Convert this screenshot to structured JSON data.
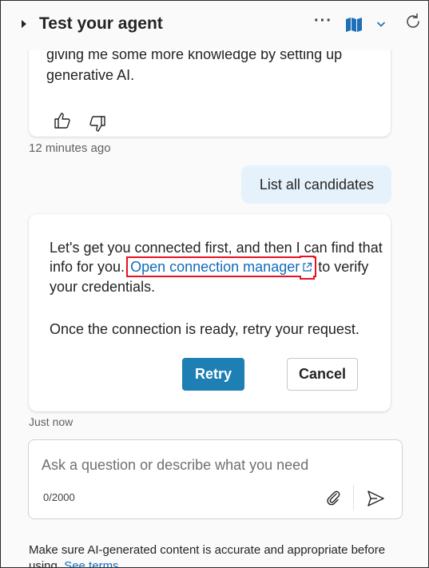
{
  "header": {
    "title": "Test your agent",
    "more_label": "···"
  },
  "chat": {
    "previous_message_line1": "giving me some more knowledge by setting up",
    "previous_message_line2": "generative AI.",
    "previous_timestamp": "12 minutes ago",
    "user_message": "List all candidates",
    "bot_message": {
      "part1": "Let's get you connected first, and then I can find that info for you.",
      "link_text": "Open connection manager",
      "part2": "to verify your credentials.",
      "paragraph2": "Once the connection is ready, retry your request."
    },
    "retry_label": "Retry",
    "cancel_label": "Cancel",
    "bot_timestamp": "Just now"
  },
  "composer": {
    "placeholder": "Ask a question or describe what you need",
    "value": "",
    "char_count": "0/2000"
  },
  "footer": {
    "disclaimer": "Make sure AI-generated content is accurate and appropriate before using.",
    "terms_link": "See terms"
  },
  "colors": {
    "accent": "#1d7fb4",
    "link": "#0f6cbd",
    "user_bubble": "#e6f2fb",
    "highlight_box": "#e81123"
  },
  "icons": [
    "collapse-arrow-icon",
    "more-options-icon",
    "map-icon",
    "chevron-down-icon",
    "refresh-icon",
    "thumbs-up-icon",
    "thumbs-down-icon",
    "external-link-icon",
    "attach-icon",
    "send-icon"
  ]
}
